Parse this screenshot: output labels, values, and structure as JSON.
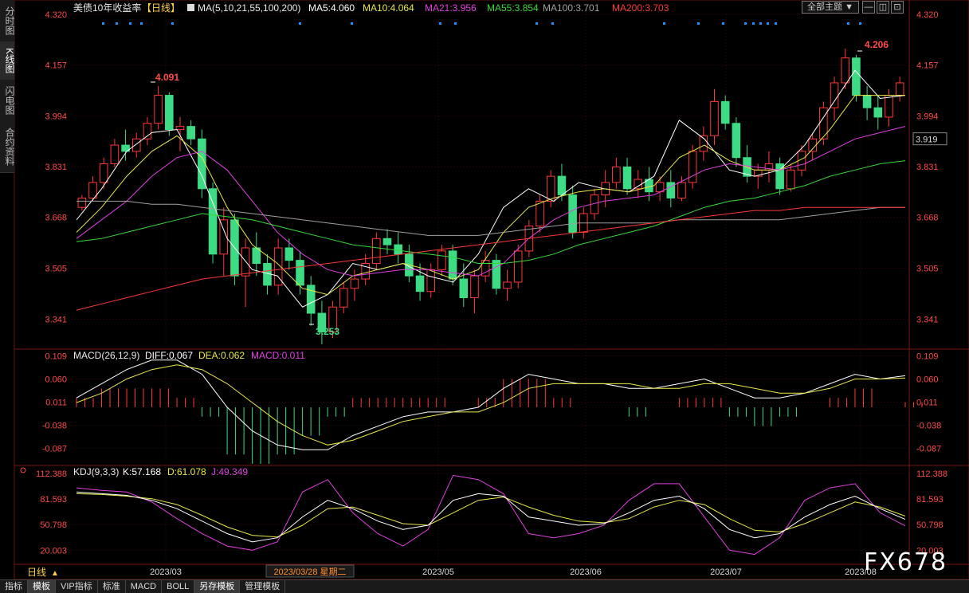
{
  "left_tabs": [
    {
      "label": "分时图",
      "active": false
    },
    {
      "label": "K线图",
      "active": true
    },
    {
      "label": "闪电图",
      "active": false
    },
    {
      "label": "合约资料",
      "active": false
    }
  ],
  "toolbar": {
    "dropdown_label": "全部主题",
    "dropdown_arrow": "▼"
  },
  "main_panel": {
    "title": "美债10年收益率",
    "period_badge": "【日线】",
    "ma_header": "MA(5,10,21,55,100,200)",
    "ma_values": [
      {
        "label": "MA5:4.060",
        "color": "#ffffff"
      },
      {
        "label": "MA10:4.064",
        "color": "#e8e84a"
      },
      {
        "label": "MA21:3.956",
        "color": "#e040e0"
      },
      {
        "label": "MA55:3.854",
        "color": "#39d839"
      },
      {
        "label": "MA100:3.701",
        "color": "#a0a0a0"
      },
      {
        "label": "MA200:3.703",
        "color": "#ff3838"
      }
    ],
    "y_ticks": [
      "4.320",
      "4.157",
      "3.994",
      "3.831",
      "3.668",
      "3.505",
      "3.341"
    ],
    "current_price": "3.919",
    "high_label": "4.206",
    "mid_high_label": "4.091",
    "low_label": "3.253"
  },
  "macd_panel": {
    "header": "MACD(26,12,9)",
    "diff": "DIFF:0.067",
    "dea": "DEA:0.062",
    "macd": "MACD:0.011",
    "y_ticks": [
      "0.109",
      "0.060",
      "0.011",
      "-0.038",
      "-0.087"
    ]
  },
  "kdj_panel": {
    "header": "KDJ(9,3,3)",
    "k": "K:57.168",
    "d": "D:61.078",
    "j": "J:49.349",
    "y_ticks": [
      "112.388",
      "81.593",
      "50.798",
      "20.003"
    ]
  },
  "x_axis": {
    "period_button": "日线",
    "period_arrow": "▲",
    "labels": [
      "2023/03",
      "2023/05",
      "2023/06",
      "2023/07",
      "2023/08"
    ],
    "cursor_label": "2023/03/28 星期二"
  },
  "bottom_tabs": [
    {
      "label": "指标",
      "active": false
    },
    {
      "label": "模板",
      "active": true
    },
    {
      "label": "VIP指标",
      "active": false
    },
    {
      "label": "标准",
      "active": false
    },
    {
      "label": "MACD",
      "active": false
    },
    {
      "label": "BOLL",
      "active": false
    },
    {
      "label": "另存模板",
      "active": true
    },
    {
      "label": "管理模板",
      "active": false
    }
  ],
  "watermark": "FX678",
  "colors": {
    "up": "#ff3838",
    "down": "#3ddc84",
    "ma5": "#ffffff",
    "ma10": "#e8e84a",
    "ma21": "#e040e0",
    "ma55": "#39d839",
    "ma100": "#a0a0a0",
    "ma200": "#ff3838",
    "diff": "#ffffff",
    "dea": "#e8e84a",
    "j": "#e040e0",
    "axis_red": "#ff4a4a",
    "event_dot": "#1e90ff"
  },
  "chart_data": {
    "type": "candlestick",
    "title": "美债10年收益率",
    "period": "日线",
    "ylim": [
      3.25,
      4.32
    ],
    "candles": [
      [
        3.7,
        3.74,
        3.69,
        3.73
      ],
      [
        3.73,
        3.8,
        3.72,
        3.78
      ],
      [
        3.78,
        3.86,
        3.76,
        3.84
      ],
      [
        3.84,
        3.92,
        3.83,
        3.9
      ],
      [
        3.9,
        3.95,
        3.85,
        3.88
      ],
      [
        3.88,
        3.94,
        3.86,
        3.92
      ],
      [
        3.92,
        3.99,
        3.9,
        3.97
      ],
      [
        3.97,
        4.09,
        3.95,
        4.06
      ],
      [
        4.06,
        4.07,
        3.93,
        3.95
      ],
      [
        3.95,
        3.99,
        3.88,
        3.96
      ],
      [
        3.96,
        3.98,
        3.9,
        3.92
      ],
      [
        3.92,
        3.95,
        3.73,
        3.76
      ],
      [
        3.76,
        3.78,
        3.52,
        3.55
      ],
      [
        3.55,
        3.7,
        3.48,
        3.66
      ],
      [
        3.66,
        3.68,
        3.45,
        3.48
      ],
      [
        3.48,
        3.6,
        3.38,
        3.57
      ],
      [
        3.57,
        3.62,
        3.48,
        3.52
      ],
      [
        3.52,
        3.55,
        3.42,
        3.45
      ],
      [
        3.45,
        3.6,
        3.42,
        3.57
      ],
      [
        3.57,
        3.6,
        3.5,
        3.53
      ],
      [
        3.53,
        3.56,
        3.42,
        3.45
      ],
      [
        3.45,
        3.48,
        3.32,
        3.36
      ],
      [
        3.36,
        3.4,
        3.26,
        3.3
      ],
      [
        3.3,
        3.4,
        3.28,
        3.38
      ],
      [
        3.38,
        3.46,
        3.36,
        3.44
      ],
      [
        3.44,
        3.5,
        3.4,
        3.47
      ],
      [
        3.47,
        3.55,
        3.45,
        3.52
      ],
      [
        3.52,
        3.62,
        3.5,
        3.6
      ],
      [
        3.6,
        3.63,
        3.55,
        3.58
      ],
      [
        3.58,
        3.62,
        3.52,
        3.55
      ],
      [
        3.55,
        3.58,
        3.46,
        3.48
      ],
      [
        3.48,
        3.52,
        3.4,
        3.43
      ],
      [
        3.43,
        3.52,
        3.41,
        3.5
      ],
      [
        3.5,
        3.58,
        3.48,
        3.56
      ],
      [
        3.56,
        3.58,
        3.45,
        3.47
      ],
      [
        3.47,
        3.52,
        3.38,
        3.41
      ],
      [
        3.41,
        3.5,
        3.36,
        3.48
      ],
      [
        3.48,
        3.56,
        3.46,
        3.53
      ],
      [
        3.53,
        3.55,
        3.42,
        3.44
      ],
      [
        3.44,
        3.5,
        3.4,
        3.46
      ],
      [
        3.46,
        3.58,
        3.44,
        3.56
      ],
      [
        3.56,
        3.66,
        3.54,
        3.64
      ],
      [
        3.64,
        3.74,
        3.62,
        3.72
      ],
      [
        3.72,
        3.82,
        3.7,
        3.8
      ],
      [
        3.8,
        3.84,
        3.72,
        3.74
      ],
      [
        3.74,
        3.77,
        3.6,
        3.62
      ],
      [
        3.62,
        3.7,
        3.6,
        3.68
      ],
      [
        3.68,
        3.76,
        3.66,
        3.74
      ],
      [
        3.74,
        3.82,
        3.7,
        3.78
      ],
      [
        3.78,
        3.86,
        3.76,
        3.83
      ],
      [
        3.83,
        3.86,
        3.74,
        3.76
      ],
      [
        3.76,
        3.82,
        3.73,
        3.79
      ],
      [
        3.79,
        3.83,
        3.72,
        3.75
      ],
      [
        3.75,
        3.8,
        3.72,
        3.78
      ],
      [
        3.78,
        3.82,
        3.7,
        3.73
      ],
      [
        3.73,
        3.8,
        3.72,
        3.78
      ],
      [
        3.78,
        3.9,
        3.76,
        3.88
      ],
      [
        3.88,
        3.96,
        3.85,
        3.93
      ],
      [
        3.93,
        4.08,
        3.9,
        4.04
      ],
      [
        4.04,
        4.06,
        3.95,
        3.97
      ],
      [
        3.97,
        3.99,
        3.83,
        3.86
      ],
      [
        3.86,
        3.9,
        3.78,
        3.8
      ],
      [
        3.8,
        3.84,
        3.76,
        3.82
      ],
      [
        3.82,
        3.88,
        3.78,
        3.84
      ],
      [
        3.84,
        3.86,
        3.74,
        3.76
      ],
      [
        3.76,
        3.84,
        3.75,
        3.82
      ],
      [
        3.82,
        3.9,
        3.8,
        3.88
      ],
      [
        3.88,
        3.94,
        3.85,
        3.92
      ],
      [
        3.92,
        4.04,
        3.9,
        4.02
      ],
      [
        4.02,
        4.12,
        3.98,
        4.1
      ],
      [
        4.1,
        4.21,
        4.08,
        4.18
      ],
      [
        4.18,
        4.19,
        4.04,
        4.06
      ],
      [
        4.06,
        4.09,
        3.98,
        4.02
      ],
      [
        4.02,
        4.06,
        3.95,
        3.99
      ],
      [
        3.99,
        4.08,
        3.96,
        4.06
      ],
      [
        4.06,
        4.12,
        4.04,
        4.1
      ]
    ],
    "ma_series": [
      {
        "name": "MA5",
        "values": [
          3.66,
          3.76,
          3.88,
          3.94,
          3.95,
          3.8,
          3.6,
          3.5,
          3.48,
          3.38,
          3.42,
          3.52,
          3.5,
          3.52,
          3.48,
          3.46,
          3.55,
          3.7,
          3.76,
          3.72,
          3.78,
          3.76,
          3.75,
          3.8,
          3.98,
          3.92,
          3.82,
          3.8,
          3.82,
          3.9,
          4.02,
          4.14,
          4.05,
          4.06
        ]
      },
      {
        "name": "MA10",
        "values": [
          3.62,
          3.7,
          3.8,
          3.88,
          3.93,
          3.86,
          3.7,
          3.58,
          3.52,
          3.44,
          3.42,
          3.48,
          3.5,
          3.52,
          3.5,
          3.47,
          3.5,
          3.62,
          3.7,
          3.73,
          3.75,
          3.76,
          3.75,
          3.77,
          3.86,
          3.9,
          3.85,
          3.82,
          3.82,
          3.86,
          3.95,
          4.06,
          4.06,
          4.06
        ]
      },
      {
        "name": "MA21",
        "values": [
          3.6,
          3.66,
          3.72,
          3.8,
          3.86,
          3.88,
          3.82,
          3.72,
          3.62,
          3.55,
          3.5,
          3.48,
          3.49,
          3.5,
          3.5,
          3.49,
          3.48,
          3.52,
          3.6,
          3.66,
          3.7,
          3.72,
          3.73,
          3.74,
          3.78,
          3.82,
          3.84,
          3.83,
          3.82,
          3.84,
          3.88,
          3.92,
          3.94,
          3.96
        ]
      },
      {
        "name": "MA55",
        "values": [
          3.59,
          3.6,
          3.62,
          3.64,
          3.66,
          3.68,
          3.67,
          3.66,
          3.64,
          3.62,
          3.6,
          3.58,
          3.57,
          3.56,
          3.55,
          3.54,
          3.52,
          3.52,
          3.53,
          3.55,
          3.58,
          3.6,
          3.62,
          3.64,
          3.67,
          3.7,
          3.72,
          3.73,
          3.75,
          3.77,
          3.8,
          3.82,
          3.84,
          3.85
        ]
      },
      {
        "name": "MA100",
        "values": [
          3.72,
          3.72,
          3.72,
          3.71,
          3.71,
          3.7,
          3.69,
          3.68,
          3.67,
          3.66,
          3.65,
          3.64,
          3.63,
          3.62,
          3.61,
          3.61,
          3.61,
          3.62,
          3.63,
          3.64,
          3.65,
          3.65,
          3.65,
          3.65,
          3.66,
          3.66,
          3.66,
          3.66,
          3.66,
          3.67,
          3.68,
          3.69,
          3.7,
          3.7
        ]
      },
      {
        "name": "MA200",
        "values": [
          3.37,
          3.39,
          3.41,
          3.43,
          3.45,
          3.47,
          3.48,
          3.49,
          3.5,
          3.51,
          3.52,
          3.53,
          3.54,
          3.55,
          3.56,
          3.57,
          3.58,
          3.59,
          3.6,
          3.61,
          3.62,
          3.63,
          3.64,
          3.65,
          3.66,
          3.67,
          3.68,
          3.69,
          3.69,
          3.7,
          3.7,
          3.7,
          3.7,
          3.7
        ]
      }
    ],
    "macd": {
      "ylim": [
        -0.12,
        0.12
      ],
      "diff": [
        0.02,
        0.05,
        0.08,
        0.1,
        0.1,
        0.07,
        0.0,
        -0.05,
        -0.08,
        -0.09,
        -0.09,
        -0.06,
        -0.04,
        -0.02,
        -0.01,
        -0.01,
        0.0,
        0.04,
        0.07,
        0.06,
        0.05,
        0.05,
        0.04,
        0.04,
        0.05,
        0.06,
        0.04,
        0.02,
        0.02,
        0.03,
        0.05,
        0.07,
        0.06,
        0.067
      ],
      "dea": [
        0.01,
        0.03,
        0.06,
        0.08,
        0.09,
        0.08,
        0.05,
        0.01,
        -0.03,
        -0.06,
        -0.08,
        -0.07,
        -0.05,
        -0.03,
        -0.02,
        -0.01,
        -0.01,
        0.01,
        0.04,
        0.05,
        0.05,
        0.05,
        0.05,
        0.04,
        0.04,
        0.05,
        0.05,
        0.04,
        0.03,
        0.03,
        0.04,
        0.06,
        0.06,
        0.062
      ],
      "hist": [
        0.02,
        0.04,
        0.04,
        0.04,
        0.02,
        -0.02,
        -0.1,
        -0.12,
        -0.1,
        -0.06,
        -0.02,
        0.02,
        0.02,
        0.02,
        0.02,
        0.0,
        0.02,
        0.06,
        0.06,
        0.02,
        0.0,
        0.0,
        -0.02,
        0.0,
        0.02,
        0.02,
        -0.02,
        -0.04,
        -0.02,
        0.0,
        0.02,
        0.04,
        0.0,
        0.011
      ]
    },
    "kdj": {
      "ylim": [
        5,
        120
      ],
      "k": [
        90,
        88,
        86,
        80,
        70,
        55,
        40,
        30,
        35,
        60,
        80,
        70,
        55,
        45,
        50,
        80,
        88,
        85,
        60,
        55,
        50,
        52,
        65,
        80,
        85,
        70,
        45,
        35,
        40,
        60,
        75,
        85,
        70,
        57.168
      ],
      "d": [
        88,
        87,
        85,
        82,
        75,
        62,
        48,
        38,
        36,
        50,
        70,
        72,
        62,
        52,
        50,
        65,
        80,
        84,
        72,
        62,
        55,
        53,
        58,
        72,
        80,
        75,
        58,
        44,
        42,
        52,
        65,
        78,
        72,
        61.078
      ],
      "j": [
        95,
        92,
        90,
        78,
        58,
        40,
        25,
        20,
        30,
        90,
        105,
        65,
        40,
        25,
        45,
        110,
        105,
        88,
        40,
        35,
        40,
        50,
        80,
        100,
        100,
        60,
        20,
        15,
        35,
        80,
        95,
        100,
        65,
        49.349
      ]
    }
  }
}
